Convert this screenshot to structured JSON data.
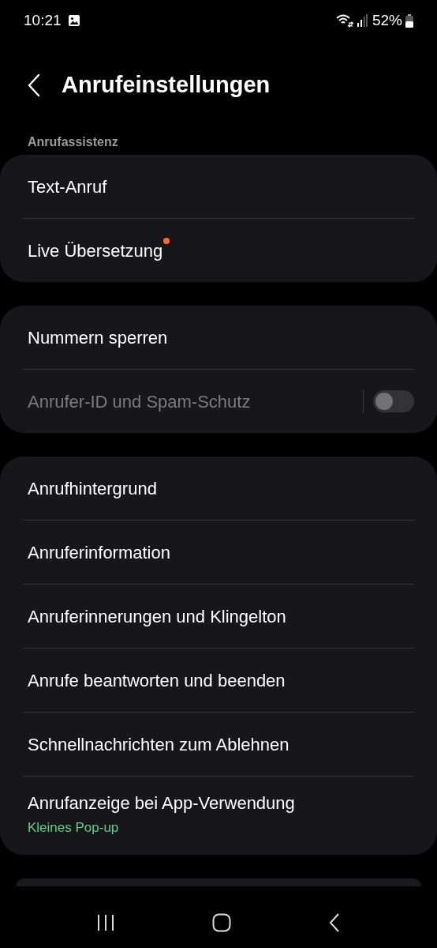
{
  "status_bar": {
    "time": "10:21",
    "battery": "52%"
  },
  "header": {
    "title": "Anrufeinstellungen"
  },
  "groups": [
    {
      "label": "Anrufassistenz",
      "items": [
        {
          "kind": "link",
          "title": "Text-Anruf",
          "badge": false
        },
        {
          "kind": "link",
          "title": "Live Übersetzung",
          "badge": true
        }
      ]
    },
    {
      "items": [
        {
          "kind": "link",
          "title": "Nummern sperren",
          "badge": false
        },
        {
          "kind": "toggle",
          "title": "Anrufer-ID und Spam-Schutz",
          "on": false,
          "disabled": true
        }
      ]
    },
    {
      "items": [
        {
          "kind": "link",
          "title": "Anrufhintergrund",
          "badge": false
        },
        {
          "kind": "link",
          "title": "Anruferinformation",
          "badge": false
        },
        {
          "kind": "link",
          "title": "Anruferinnerungen und Klingelton",
          "badge": false
        },
        {
          "kind": "link",
          "title": "Anrufe beantworten und beenden",
          "badge": false
        },
        {
          "kind": "link",
          "title": "Schnellnachrichten zum Ablehnen",
          "badge": false
        },
        {
          "kind": "link",
          "title": "Anrufanzeige bei App-Verwendung",
          "subtitle": "Kleines Pop-up",
          "badge": false
        }
      ]
    }
  ]
}
